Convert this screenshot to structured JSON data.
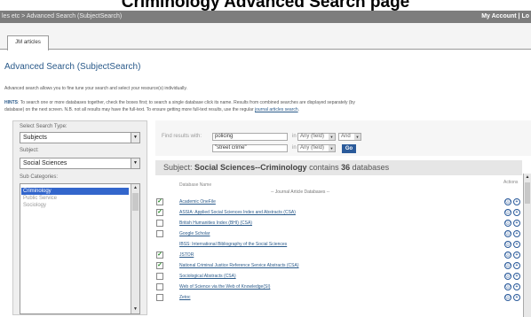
{
  "caption": "Criminology Advanced Search page",
  "topbar": {
    "breadcrumb": "les etc > Advanced Search (SubjectSearch)",
    "account": "My Account | Lo"
  },
  "tab": {
    "label": "JM articles"
  },
  "page_title": "Advanced Search (SubjectSearch)",
  "intro": "Advanced search allows you to fine tune your search and select your resource(s) individually.",
  "hints": {
    "label": "HINTS",
    "text_line1": ": To search one or more databases together, check the boxes first; to search a single database click its name. Results from combined searches are displayed separately (by",
    "text_line2": "database) on the next screen. N.B. not all results may have the full-text. To ensure getting more full-text results, use the regular ",
    "link": "journal articles search",
    "end": "."
  },
  "left": {
    "search_type_label": "Select Search Type:",
    "search_type_value": "Subjects",
    "subject_label": "Subject:",
    "subject_value": "Social Sciences",
    "subcategories_label": "Sub Categories:",
    "subcategories": [
      "Criminology",
      "Public Service",
      "Sociology"
    ]
  },
  "search": {
    "find_label": "Find results with:",
    "term1": "policing",
    "term2": "\"street crime\"",
    "in_label1": "in",
    "in_label2": "in",
    "field1": "Any (field)",
    "field2": "Any (field)",
    "bool": "And",
    "go": "Go"
  },
  "subject_bar": {
    "prefix": "Subject: ",
    "subject": "Social Sciences--Criminology",
    "middle": " contains ",
    "count": "36",
    "suffix": " databases"
  },
  "table": {
    "col_name": "Database Name",
    "col_actions": "Actions",
    "section": "-- Journal Article Databases --",
    "rows": [
      {
        "name": "Academic OneFile",
        "checked": true
      },
      {
        "name": "ASSIA: Applied Social Sciences Index and Abstracts (CSA)",
        "checked": true
      },
      {
        "name": "British Humanities Index (BHI) (CSA)",
        "checked": false
      },
      {
        "name": "Google Scholar",
        "checked": false
      },
      {
        "name": "IBSS: International Bibliography of the Social Sciences",
        "checked": false
      },
      {
        "name": "JSTOR",
        "checked": true
      },
      {
        "name": "National Criminal Justice Reference Service Abstracts (CSA)",
        "checked": true
      },
      {
        "name": "Sociological Abstracts (CSA)",
        "checked": false
      },
      {
        "name": "Web of Science via the Web of Knowledge(SI)",
        "checked": false
      },
      {
        "name": "Zetoc",
        "checked": false
      }
    ]
  },
  "icons": {
    "info": "ⓘ",
    "add": "+",
    "check": "✓",
    "down": "▼",
    "up": "▲"
  }
}
